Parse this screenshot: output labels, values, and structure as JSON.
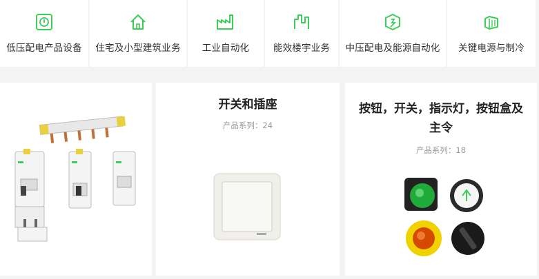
{
  "nav": {
    "items": [
      {
        "label": "低压配电产品设备",
        "icon": "power-button-icon"
      },
      {
        "label": "住宅及小型建筑业务",
        "icon": "house-icon"
      },
      {
        "label": "工业自动化",
        "icon": "factory-icon"
      },
      {
        "label": "能效楼宇业务",
        "icon": "building-icon"
      },
      {
        "label": "中压配电及能源自动化",
        "icon": "energy-icon"
      },
      {
        "label": "关键电源与制冷",
        "icon": "datacenter-icon"
      }
    ],
    "accent": "#3dcd58"
  },
  "cards": [
    {
      "title": "",
      "sub": "",
      "image": "circuit-breakers-image"
    },
    {
      "title": "开关和插座",
      "sub": "产品系列：24",
      "image": "wall-switch-image"
    },
    {
      "title_line1": "按钮，开关，指示灯，按钮盒及",
      "title_line2": "主令",
      "sub": "产品系列：18",
      "image": "push-buttons-image"
    }
  ]
}
